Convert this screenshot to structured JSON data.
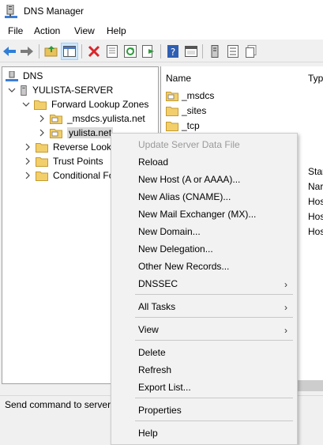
{
  "window": {
    "title": "DNS Manager"
  },
  "menubar": {
    "items": [
      "File",
      "Action",
      "View",
      "Help"
    ]
  },
  "toolbar": {
    "buttons": [
      "back-icon",
      "forward-icon",
      "up-folder-icon",
      "show-hide-tree-icon",
      "delete-icon",
      "properties-icon",
      "refresh-icon",
      "export-list-icon",
      "help-icon",
      "console-icon",
      "server-icon",
      "list-icon",
      "clipboard-icon"
    ]
  },
  "tree": {
    "root": "DNS",
    "server": "YULISTA-SERVER",
    "forward": "Forward Lookup Zones",
    "msdcs_zone": "_msdcs.yulista.net",
    "selected_zone": "yulista.net",
    "reverse": "Reverse Looku",
    "trust": "Trust Points",
    "conditional": "Conditional Fo"
  },
  "list": {
    "columns": [
      "Name",
      "Typ"
    ],
    "rows": [
      "_msdcs",
      "_sites",
      "_tcp"
    ],
    "truncated_types": [
      "Star",
      "Nar",
      "Hos",
      "Hos",
      "Hos"
    ]
  },
  "status": {
    "text": "Send command to server"
  },
  "context_menu": {
    "update": "Update Server Data File",
    "reload": "Reload",
    "new_host": "New Host (A or AAAA)...",
    "new_alias": "New Alias (CNAME)...",
    "new_mx": "New Mail Exchanger (MX)...",
    "new_domain": "New Domain...",
    "new_delegation": "New Delegation...",
    "other_records": "Other New Records...",
    "dnssec": "DNSSEC",
    "all_tasks": "All Tasks",
    "view": "View",
    "delete": "Delete",
    "refresh": "Refresh",
    "export": "Export List...",
    "properties": "Properties",
    "help": "Help",
    "submenu_arrow": "›"
  }
}
